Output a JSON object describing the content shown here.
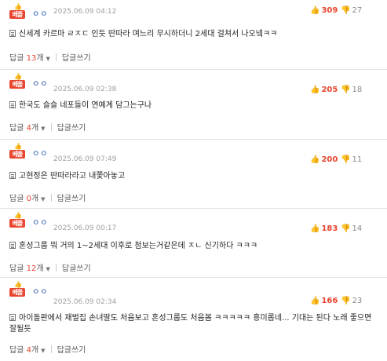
{
  "comments": [
    {
      "badge_label": "베플",
      "nickname": "ㅇㅇ",
      "date": "2025.06.09 04:12",
      "likes": "309",
      "dislikes": "27",
      "text": "신세계 카르마 ㄹㅈㄷ 인듯 딴따라 며느리 무시하더니 2세대 걸쳐서 나오넼ㅋㅋ",
      "reply_label": "답글",
      "reply_count": "13",
      "reply_unit": "개",
      "write_label": "답글쓰기"
    },
    {
      "badge_label": "베플",
      "nickname": "ㅇㅇ",
      "date": "2025.06.09 02:38",
      "likes": "205",
      "dislikes": "18",
      "text": "한국도 슬슬 네포들이 연예계 담그는구나",
      "reply_label": "답글",
      "reply_count": "4",
      "reply_unit": "개",
      "write_label": "답글쓰기"
    },
    {
      "badge_label": "베플",
      "nickname": "ㅇㅇ",
      "date": "2025.06.09 07:49",
      "likes": "200",
      "dislikes": "11",
      "text": "고현정은 딴따라라고 내쫓아놓고",
      "reply_label": "답글",
      "reply_count": "0",
      "reply_unit": "개",
      "write_label": "답글쓰기"
    },
    {
      "badge_label": "베플",
      "nickname": "ㅇㅇ",
      "date": "2025.06.09 00:17",
      "likes": "183",
      "dislikes": "14",
      "text": "혼성그룹 뭐 거의 1~2세대 이후로 첨보는거같은데 ㅈㄴ 신기하다 ㅋㅋㅋ",
      "reply_label": "답글",
      "reply_count": "12",
      "reply_unit": "개",
      "write_label": "답글쓰기"
    },
    {
      "badge_label": "베플",
      "nickname": "ㅇㅇ",
      "date": "2025.06.09 02:34",
      "likes": "166",
      "dislikes": "23",
      "text": "아이돌판에서 재벌집 손녀딸도 처음보고 혼성그룹도 처음봄 ㅋㅋㅋㅋㅋ 흥미롭네... 기대는 된다 노래 좋으면 잘될듯",
      "reply_label": "답글",
      "reply_count": "4",
      "reply_unit": "개",
      "write_label": "답글쓰기"
    }
  ],
  "icons": {
    "badge": "thumbs-up-badge-icon",
    "like": "thumbs-up-icon",
    "dislike": "thumbs-down-icon",
    "text": "document-icon",
    "caret": "caret-down-icon"
  },
  "colors": {
    "accent": "#e8442e",
    "nickname": "#1f4fb0",
    "muted": "#a0a0a0"
  }
}
